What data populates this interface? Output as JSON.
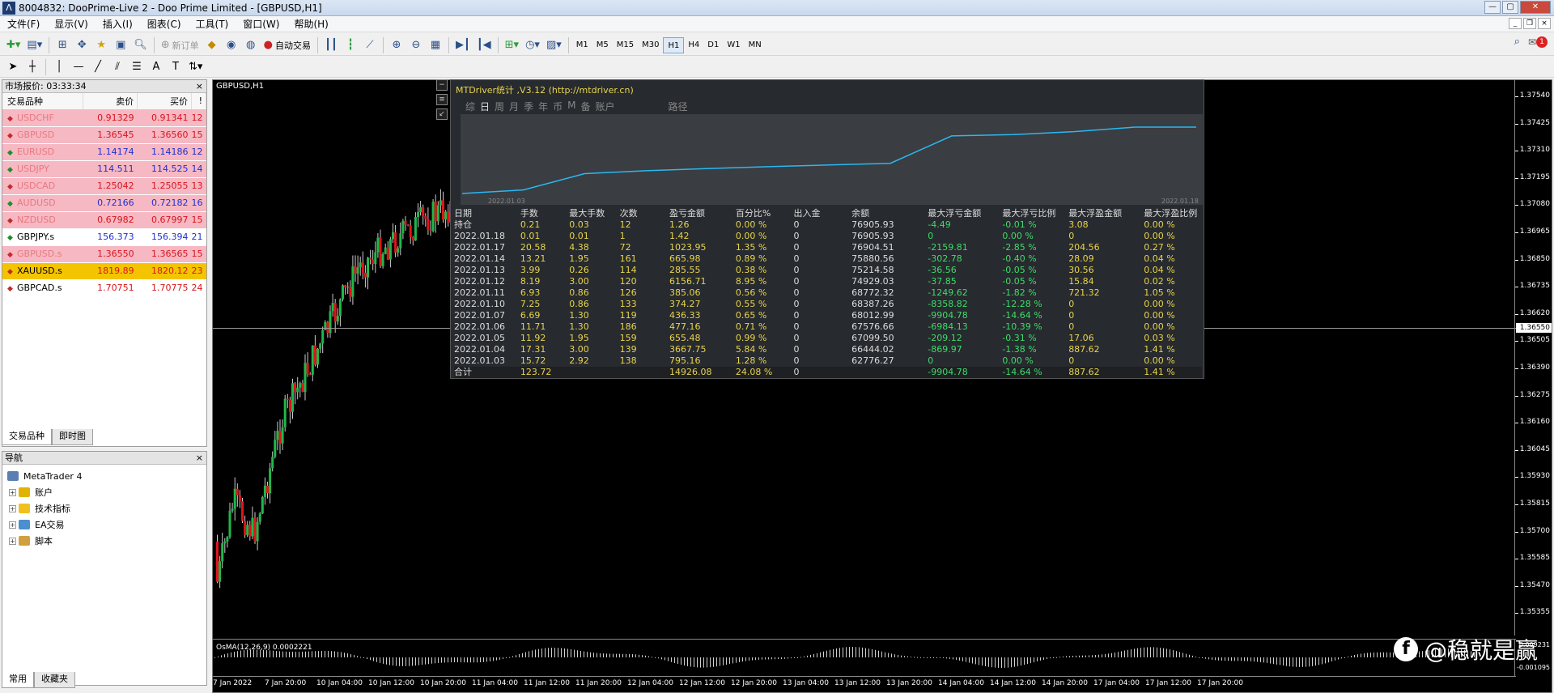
{
  "window": {
    "title": "8004832: DooPrime-Live 2 - Doo Prime Limited - [GBPUSD,H1]"
  },
  "menu": [
    "文件(F)",
    "显示(V)",
    "插入(I)",
    "图表(C)",
    "工具(T)",
    "窗口(W)",
    "帮助(H)"
  ],
  "toolbar": {
    "new_order": "新订单",
    "auto_trade": "自动交易",
    "timeframes": [
      "M1",
      "M5",
      "M15",
      "M30",
      "H1",
      "H4",
      "D1",
      "W1",
      "MN"
    ],
    "active_tf": "H1",
    "notification_count": "1"
  },
  "market_watch": {
    "title": "市场报价: 03:33:34",
    "columns": [
      "交易品种",
      "卖价",
      "买价",
      "!"
    ],
    "rows": [
      {
        "symbol": "USDCHF",
        "bid": "0.91329",
        "ask": "0.91341",
        "spread": "12",
        "hl": true,
        "dir": "down"
      },
      {
        "symbol": "GBPUSD",
        "bid": "1.36545",
        "ask": "1.36560",
        "spread": "15",
        "hl": true,
        "dir": "down"
      },
      {
        "symbol": "EURUSD",
        "bid": "1.14174",
        "ask": "1.14186",
        "spread": "12",
        "hl": true,
        "dir": "up"
      },
      {
        "symbol": "USDJPY",
        "bid": "114.511",
        "ask": "114.525",
        "spread": "14",
        "hl": true,
        "dir": "up"
      },
      {
        "symbol": "USDCAD",
        "bid": "1.25042",
        "ask": "1.25055",
        "spread": "13",
        "hl": true,
        "dir": "down"
      },
      {
        "symbol": "AUDUSD",
        "bid": "0.72166",
        "ask": "0.72182",
        "spread": "16",
        "hl": true,
        "dir": "up"
      },
      {
        "symbol": "NZDUSD",
        "bid": "0.67982",
        "ask": "0.67997",
        "spread": "15",
        "hl": true,
        "dir": "down"
      },
      {
        "symbol": "GBPJPY.s",
        "bid": "156.373",
        "ask": "156.394",
        "spread": "21",
        "hl": false,
        "dir": "up"
      },
      {
        "symbol": "GBPUSD.s",
        "bid": "1.36550",
        "ask": "1.36565",
        "spread": "15",
        "hl": true,
        "dir": "down"
      },
      {
        "symbol": "XAUUSD.s",
        "bid": "1819.89",
        "ask": "1820.12",
        "spread": "23",
        "hl": "gold",
        "dir": "down"
      },
      {
        "symbol": "GBPCAD.s",
        "bid": "1.70751",
        "ask": "1.70775",
        "spread": "24",
        "hl": false,
        "dir": "down"
      }
    ],
    "tabs": [
      "交易品种",
      "即时图"
    ]
  },
  "navigator": {
    "title": "导航",
    "root": "MetaTrader 4",
    "items": [
      "账户",
      "技术指标",
      "EA交易",
      "脚本"
    ],
    "tabs": [
      "常用",
      "收藏夹"
    ]
  },
  "chart": {
    "title": "GBPUSD,H1",
    "current_price": "1.36550",
    "price_labels": [
      "1.37540",
      "1.37425",
      "1.37310",
      "1.37195",
      "1.37080",
      "1.36965",
      "1.36850",
      "1.36735",
      "1.36620",
      "1.36505",
      "1.36390",
      "1.36275",
      "1.36160",
      "1.36045",
      "1.35930",
      "1.35815",
      "1.35700",
      "1.35585",
      "1.35470",
      "1.35355"
    ],
    "time_labels": [
      "7 Jan 2022",
      "7 Jan 20:00",
      "10 Jan 04:00",
      "10 Jan 12:00",
      "10 Jan 20:00",
      "11 Jan 04:00",
      "11 Jan 12:00",
      "11 Jan 20:00",
      "12 Jan 04:00",
      "12 Jan 12:00",
      "12 Jan 20:00",
      "13 Jan 04:00",
      "13 Jan 12:00",
      "13 Jan 20:00",
      "14 Jan 04:00",
      "14 Jan 12:00",
      "14 Jan 20:00",
      "17 Jan 04:00",
      "17 Jan 12:00",
      "17 Jan 20:00"
    ],
    "osma_label": "OsMA(12,26,9) 0.0002221",
    "osma_axis": [
      "0.009231",
      "-0.001095"
    ]
  },
  "stats": {
    "header": "MTDriver统计 ,V3.12 (http://mtdriver.cn)",
    "periods": [
      "综",
      "日",
      "周",
      "月",
      "季",
      "年",
      "币",
      "M",
      "备",
      "账户"
    ],
    "active_period": "日",
    "path_label": "路径",
    "chart_dates": [
      "2022.01.03",
      "2022.01.18"
    ],
    "columns": [
      "日期",
      "手数",
      "最大手数",
      "次数",
      "盈亏金额",
      "百分比%",
      "出入金",
      "余额",
      "最大浮亏金额",
      "最大浮亏比例",
      "最大浮盈金额",
      "最大浮盈比例"
    ],
    "rows": [
      [
        "持仓",
        "0.21",
        "0.03",
        "12",
        "1.26",
        "0.00 %",
        "0",
        "76905.93",
        "-4.49",
        "-0.01 %",
        "3.08",
        "0.00 %"
      ],
      [
        "2022.01.18",
        "0.01",
        "0.01",
        "1",
        "1.42",
        "0.00 %",
        "0",
        "76905.93",
        "0",
        "0.00 %",
        "0",
        "0.00 %"
      ],
      [
        "2022.01.17",
        "20.58",
        "4.38",
        "72",
        "1023.95",
        "1.35 %",
        "0",
        "76904.51",
        "-2159.81",
        "-2.85 %",
        "204.56",
        "0.27 %"
      ],
      [
        "2022.01.14",
        "13.21",
        "1.95",
        "161",
        "665.98",
        "0.89 %",
        "0",
        "75880.56",
        "-302.78",
        "-0.40 %",
        "28.09",
        "0.04 %"
      ],
      [
        "2022.01.13",
        "3.99",
        "0.26",
        "114",
        "285.55",
        "0.38 %",
        "0",
        "75214.58",
        "-36.56",
        "-0.05 %",
        "30.56",
        "0.04 %"
      ],
      [
        "2022.01.12",
        "8.19",
        "3.00",
        "120",
        "6156.71",
        "8.95 %",
        "0",
        "74929.03",
        "-37.85",
        "-0.05 %",
        "15.84",
        "0.02 %"
      ],
      [
        "2022.01.11",
        "6.93",
        "0.86",
        "126",
        "385.06",
        "0.56 %",
        "0",
        "68772.32",
        "-1249.62",
        "-1.82 %",
        "721.32",
        "1.05 %"
      ],
      [
        "2022.01.10",
        "7.25",
        "0.86",
        "133",
        "374.27",
        "0.55 %",
        "0",
        "68387.26",
        "-8358.82",
        "-12.28 %",
        "0",
        "0.00 %"
      ],
      [
        "2022.01.07",
        "6.69",
        "1.30",
        "119",
        "436.33",
        "0.65 %",
        "0",
        "68012.99",
        "-9904.78",
        "-14.64 %",
        "0",
        "0.00 %"
      ],
      [
        "2022.01.06",
        "11.71",
        "1.30",
        "186",
        "477.16",
        "0.71 %",
        "0",
        "67576.66",
        "-6984.13",
        "-10.39 %",
        "0",
        "0.00 %"
      ],
      [
        "2022.01.05",
        "11.92",
        "1.95",
        "159",
        "655.48",
        "0.99 %",
        "0",
        "67099.50",
        "-209.12",
        "-0.31 %",
        "17.06",
        "0.03 %"
      ],
      [
        "2022.01.04",
        "17.31",
        "3.00",
        "139",
        "3667.75",
        "5.84 %",
        "0",
        "66444.02",
        "-869.97",
        "-1.38 %",
        "887.62",
        "1.41 %"
      ],
      [
        "2022.01.03",
        "15.72",
        "2.92",
        "138",
        "795.16",
        "1.28 %",
        "0",
        "62776.27",
        "0",
        "0.00 %",
        "0",
        "0.00 %"
      ],
      [
        "合计",
        "123.72",
        "",
        "",
        "14926.08",
        "24.08 %",
        "0",
        "",
        "-9904.78",
        "-14.64 %",
        "887.62",
        "1.41 %"
      ]
    ]
  },
  "watermark": "@稳就是赢"
}
